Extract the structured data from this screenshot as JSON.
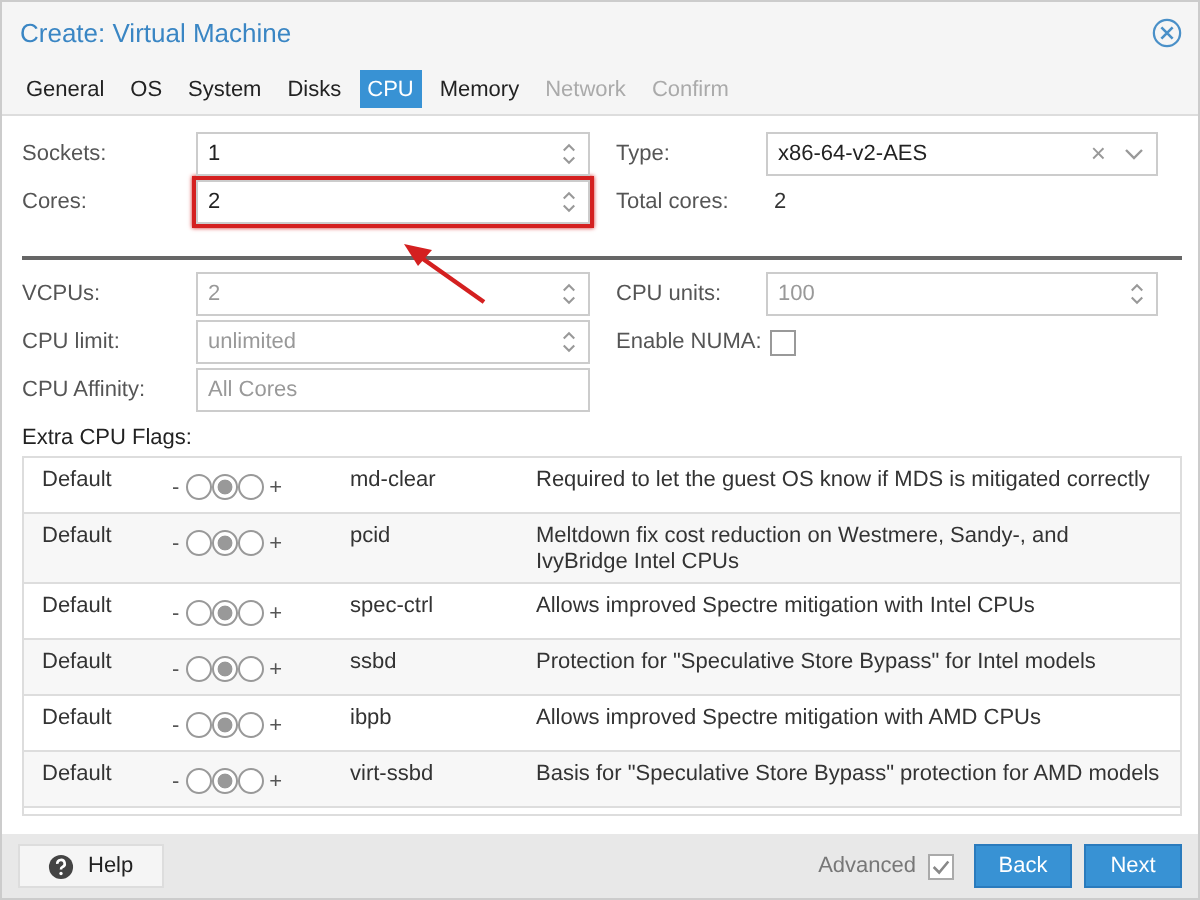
{
  "window": {
    "title": "Create: Virtual Machine"
  },
  "tabs": [
    {
      "label": "General",
      "selected": false,
      "disabled": false
    },
    {
      "label": "OS",
      "selected": false,
      "disabled": false
    },
    {
      "label": "System",
      "selected": false,
      "disabled": false
    },
    {
      "label": "Disks",
      "selected": false,
      "disabled": false
    },
    {
      "label": "CPU",
      "selected": true,
      "disabled": false
    },
    {
      "label": "Memory",
      "selected": false,
      "disabled": false
    },
    {
      "label": "Network",
      "selected": false,
      "disabled": true
    },
    {
      "label": "Confirm",
      "selected": false,
      "disabled": true
    }
  ],
  "top_fields": [
    {
      "label": "Sockets:",
      "kind": "spinner",
      "value": "1"
    },
    {
      "label": "Type:",
      "kind": "combo",
      "value": "x86-64-v2-AES",
      "clear": "×"
    },
    {
      "label": "Cores:",
      "kind": "spinner",
      "value": "2",
      "highlighted": true
    },
    {
      "label": "Total cores:",
      "kind": "display",
      "value": "2"
    }
  ],
  "advanced_fields": [
    {
      "label": "VCPUs:",
      "kind": "spinner",
      "value": "2",
      "disabled": true
    },
    {
      "label": "CPU units:",
      "kind": "spinner",
      "placeholder": "100"
    },
    {
      "label": "CPU limit:",
      "kind": "spinner",
      "placeholder": "unlimited"
    },
    {
      "label": "Enable NUMA:",
      "kind": "checkbox",
      "checked": false
    },
    {
      "label": "CPU Affinity:",
      "kind": "text",
      "placeholder": "All Cores"
    }
  ],
  "flags_title": "Extra CPU Flags:",
  "flags": [
    {
      "state": "Default",
      "minus": "-",
      "plus": "+",
      "radios": [
        {
          "selected": false
        },
        {
          "selected": true
        },
        {
          "selected": false
        }
      ],
      "name": "md-clear",
      "description": "Required to let the guest OS know if MDS is mitigated correctly"
    },
    {
      "state": "Default",
      "minus": "-",
      "plus": "+",
      "radios": [
        {
          "selected": false
        },
        {
          "selected": true
        },
        {
          "selected": false
        }
      ],
      "name": "pcid",
      "description": "Meltdown fix cost reduction on Westmere, Sandy-, and IvyBridge Intel CPUs"
    },
    {
      "state": "Default",
      "minus": "-",
      "plus": "+",
      "radios": [
        {
          "selected": false
        },
        {
          "selected": true
        },
        {
          "selected": false
        }
      ],
      "name": "spec-ctrl",
      "description": "Allows improved Spectre mitigation with Intel CPUs"
    },
    {
      "state": "Default",
      "minus": "-",
      "plus": "+",
      "radios": [
        {
          "selected": false
        },
        {
          "selected": true
        },
        {
          "selected": false
        }
      ],
      "name": "ssbd",
      "description": "Protection for \"Speculative Store Bypass\" for Intel models"
    },
    {
      "state": "Default",
      "minus": "-",
      "plus": "+",
      "radios": [
        {
          "selected": false
        },
        {
          "selected": true
        },
        {
          "selected": false
        }
      ],
      "name": "ibpb",
      "description": "Allows improved Spectre mitigation with AMD CPUs"
    },
    {
      "state": "Default",
      "minus": "-",
      "plus": "+",
      "radios": [
        {
          "selected": false
        },
        {
          "selected": true
        },
        {
          "selected": false
        }
      ],
      "name": "virt-ssbd",
      "description": "Basis for \"Speculative Store Bypass\" protection for AMD models"
    }
  ],
  "footer": {
    "help": "Help",
    "advanced_label": "Advanced",
    "advanced_checked": true,
    "back": "Back",
    "next": "Next"
  }
}
